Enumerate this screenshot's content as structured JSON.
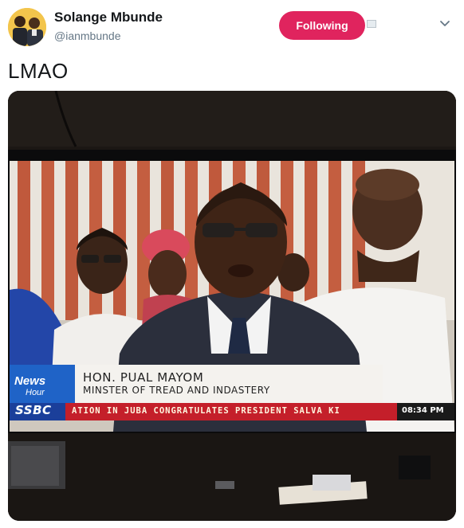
{
  "user": {
    "display_name": "Solange Mbunde",
    "handle": "@ianmbunde",
    "avatar": "avatar-photo"
  },
  "actions": {
    "follow_label": "Following",
    "follow_color": "#e0245e",
    "menu_icon": "chevron-down-icon"
  },
  "tweet": {
    "text": "LMAO"
  },
  "media": {
    "description_icon": "tv-photo",
    "broadcast": {
      "program_logo_main": "News",
      "program_logo_sub": "Hour",
      "name_caption": "HON. PUAL MAYOM",
      "title_caption": "MINSTER OF TREAD AND INDASTERY",
      "station": "SSBC",
      "ticker": "ATION IN JUBA CONGRATULATES PRESIDENT SALVA KI",
      "time": "08:34 PM"
    }
  }
}
